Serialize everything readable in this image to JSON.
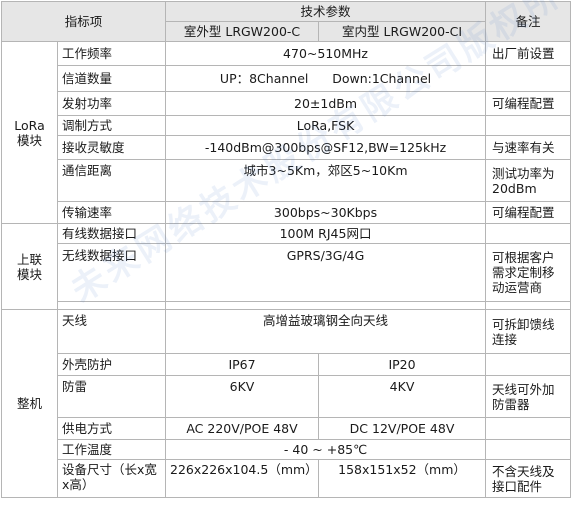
{
  "header": {
    "item": "指标项",
    "spec": "技术参数",
    "outdoor": "室外型 LRGW200-C",
    "indoor": "室内型 LRGW200-CI",
    "note": "备注"
  },
  "groups": {
    "lora": "LoRa\n模块",
    "uplink": "上联\n模块",
    "unit": "整机"
  },
  "rows": [
    {
      "name": "工作频率",
      "value": "470~510MHz",
      "note": "出厂前设置"
    },
    {
      "name": "信道数量",
      "value": "UP：8Channel      Down:1Channel",
      "note": ""
    },
    {
      "name": "发射功率",
      "value": "20±1dBm",
      "note": "可编程配置"
    },
    {
      "name": "调制方式",
      "value": "LoRa,FSK",
      "note": ""
    },
    {
      "name": "接收灵敏度",
      "value": "-140dBm@300bps@SF12,BW=125kHz",
      "note": "与速率有关"
    },
    {
      "name": "通信距离",
      "value": "城市3~5Km，郊区5~10Km",
      "note": "测试功率为20dBm"
    },
    {
      "name": "传输速率",
      "value": "300bps~30Kbps",
      "note": "可编程配置"
    },
    {
      "name": "有线数据接口",
      "value": "100M RJ45网口",
      "note": ""
    },
    {
      "name": "无线数据接口",
      "value": "GPRS/3G/4G",
      "note": "可根据客户需求定制移动运营商"
    },
    {
      "name": "天线",
      "value": "高增益玻璃钢全向天线",
      "note": "可拆卸馈线连接"
    },
    {
      "name": "外壳防护",
      "outdoor": "IP67",
      "indoor": "IP20",
      "note": ""
    },
    {
      "name": "防雷",
      "outdoor": "6KV",
      "indoor": "4KV",
      "note": "天线可外加防雷器"
    },
    {
      "name": "供电方式",
      "outdoor": "AC 220V/POE 48V",
      "indoor": "DC 12V/POE 48V",
      "note": ""
    },
    {
      "name": "工作温度",
      "value": "- 40 ~ +85℃",
      "note": ""
    },
    {
      "name": "设备尺寸（长x宽x高）",
      "outdoor": "226x226x104.5（mm）",
      "indoor": "158x151x52（mm）",
      "note": "不含天线及接口配件"
    }
  ],
  "watermark": "未来网络技术股份有限公司版权所有"
}
